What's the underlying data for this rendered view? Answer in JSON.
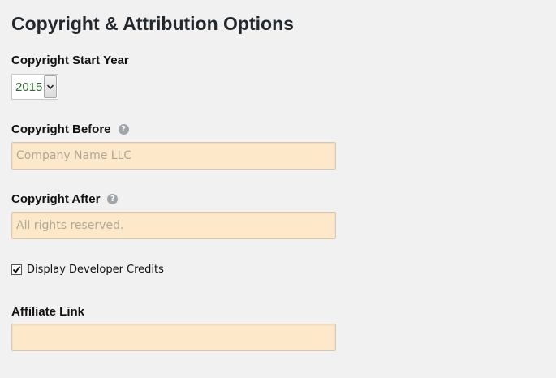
{
  "page": {
    "title": "Copyright & Attribution Options"
  },
  "start_year": {
    "label": "Copyright Start Year",
    "value": "2015"
  },
  "before": {
    "label": "Copyright Before",
    "placeholder": "Company Name LLC",
    "value": ""
  },
  "after": {
    "label": "Copyright After",
    "placeholder": "All rights reserved.",
    "value": ""
  },
  "credits": {
    "label": "Display Developer Credits",
    "checked": true
  },
  "affiliate": {
    "label": "Affiliate Link",
    "placeholder": "",
    "value": ""
  },
  "icons": {
    "help": "question-circle-icon",
    "dropdown": "chevron-down-icon",
    "check": "checkmark-icon"
  },
  "colors": {
    "background": "#f1f1f1",
    "input_bg": "#fde8ca",
    "year_text": "#2e6b2f"
  }
}
